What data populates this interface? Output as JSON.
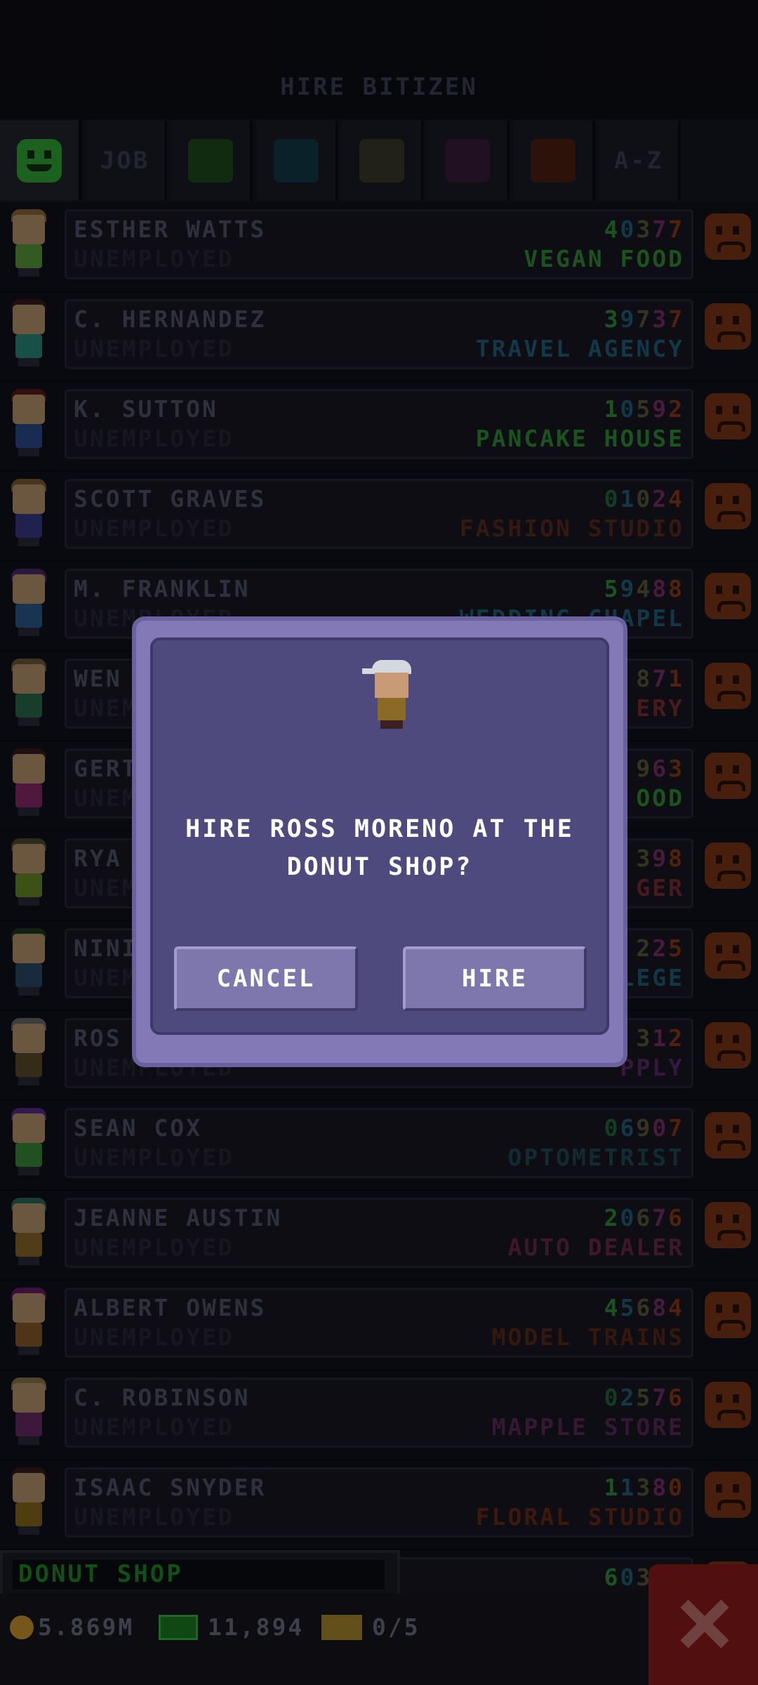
{
  "header": {
    "title": "HIRE BITIZEN"
  },
  "filters": [
    {
      "kind": "smiley",
      "color": "#33a83a"
    },
    {
      "kind": "text",
      "label": "JOB"
    },
    {
      "kind": "swatch",
      "color": "#1c4a1d"
    },
    {
      "kind": "swatch",
      "color": "#123a48"
    },
    {
      "kind": "swatch",
      "color": "#3a3a28"
    },
    {
      "kind": "swatch",
      "color": "#3a1a3c"
    },
    {
      "kind": "swatch",
      "color": "#4a2212"
    },
    {
      "kind": "text",
      "label": "A-Z"
    }
  ],
  "bitizens": [
    {
      "name": "ESTHER WATTS",
      "status": "UNEMPLOYED",
      "number": "40377",
      "business": "VEGAN FOOD",
      "biz_color": "#2f8f34",
      "digit_colors": [
        "#2f8f34",
        "#1f5f7a",
        "#5a5a3a",
        "#7a2f6a",
        "#8a3a18"
      ],
      "hair": "#8a6a3a",
      "shirt": "#5a9a3a"
    },
    {
      "name": "C. HERNANDEZ",
      "status": "UNEMPLOYED",
      "number": "39737",
      "business": "TRAVEL AGENCY",
      "biz_color": "#1f5f7a",
      "digit_colors": [
        "#2f8f34",
        "#1f5f7a",
        "#5a5a3a",
        "#7a2f6a",
        "#8a3a18"
      ],
      "hair": "#3a1a1a",
      "shirt": "#2a8a7a"
    },
    {
      "name": "K. SUTTON",
      "status": "UNEMPLOYED",
      "number": "10592",
      "business": "PANCAKE HOUSE",
      "biz_color": "#2f8f34",
      "digit_colors": [
        "#2f8f34",
        "#1f5f7a",
        "#5a5a3a",
        "#7a2f6a",
        "#8a3a18"
      ],
      "hair": "#5a1a1a",
      "shirt": "#2a4a8a"
    },
    {
      "name": "SCOTT GRAVES",
      "status": "UNEMPLOYED",
      "number": "01024",
      "business": "FASHION STUDIO",
      "biz_color": "#5a2a20",
      "digit_colors": [
        "#1f6a3a",
        "#1f5f7a",
        "#5a5a3a",
        "#7a2f6a",
        "#8a3a18"
      ],
      "hair": "#7a5a3a",
      "shirt": "#3a3a8a"
    },
    {
      "name": "M. FRANKLIN",
      "status": "UNEMPLOYED",
      "number": "59488",
      "business": "WEDDING CHAPEL",
      "biz_color": "#1f5f7a",
      "digit_colors": [
        "#2f8f34",
        "#1f5f7a",
        "#5a5a3a",
        "#7a2f6a",
        "#8a3a18"
      ],
      "hair": "#4a2a6a",
      "shirt": "#2a5a8a"
    },
    {
      "name": "WEN",
      "status": "UNEMPLOYED",
      "number": "871",
      "business": "ERY",
      "biz_color": "#7a2f30",
      "digit_colors": [
        "#5a5a3a",
        "#7a2f6a",
        "#8a3a18"
      ],
      "hair": "#6a5a3a",
      "shirt": "#2a6a4a"
    },
    {
      "name": "GERT",
      "status": "UNEMPLOYED",
      "number": "963",
      "business": "OOD",
      "biz_color": "#2f8f34",
      "digit_colors": [
        "#5a5a3a",
        "#7a2f6a",
        "#8a3a18"
      ],
      "hair": "#3a1a1a",
      "shirt": "#8a2a6a"
    },
    {
      "name": "RYA",
      "status": "UNEMPLOYED",
      "number": "398",
      "business": "GER",
      "biz_color": "#7a2f30",
      "digit_colors": [
        "#5a5a3a",
        "#7a2f6a",
        "#8a3a18"
      ],
      "hair": "#4a4a2a",
      "shirt": "#6a8a2a"
    },
    {
      "name": "NINI",
      "status": "UNEMPLOYED",
      "number": "225",
      "business": "LEGE",
      "biz_color": "#1f5f7a",
      "digit_colors": [
        "#5a5a3a",
        "#7a2f6a",
        "#8a3a18"
      ],
      "hair": "#1a3a1a",
      "shirt": "#2a4a6a"
    },
    {
      "name": "ROS",
      "status": "UNEMPLOYED",
      "number": "312",
      "business": "PPLY",
      "biz_color": "#5a2a6a",
      "digit_colors": [
        "#5a5a3a",
        "#7a2f6a",
        "#8a3a18"
      ],
      "hair": "#6a6a6a",
      "shirt": "#5a4a2a"
    },
    {
      "name": "SEAN COX",
      "status": "UNEMPLOYED",
      "number": "06907",
      "business": "OPTOMETRIST",
      "biz_color": "#1f4a58",
      "digit_colors": [
        "#1f6a3a",
        "#1f5f7a",
        "#5a5a3a",
        "#7a2f6a",
        "#8a3a18"
      ],
      "hair": "#5a2a8a",
      "shirt": "#3a8a3a"
    },
    {
      "name": "JEANNE AUSTIN",
      "status": "UNEMPLOYED",
      "number": "20676",
      "business": "AUTO DEALER",
      "biz_color": "#6a2a4a",
      "digit_colors": [
        "#2f8f34",
        "#1f5f7a",
        "#5a5a3a",
        "#7a2f6a",
        "#8a3a18"
      ],
      "hair": "#2a6a5a",
      "shirt": "#8a6a2a"
    },
    {
      "name": "ALBERT OWENS",
      "status": "UNEMPLOYED",
      "number": "45684",
      "business": "MODEL TRAINS",
      "biz_color": "#5a2a18",
      "digit_colors": [
        "#2f8f34",
        "#1f5f7a",
        "#5a5a3a",
        "#7a2f6a",
        "#8a3a18"
      ],
      "hair": "#6a1a6a",
      "shirt": "#8a5a2a"
    },
    {
      "name": "C. ROBINSON",
      "status": "UNEMPLOYED",
      "number": "02576",
      "business": "MAPPLE STORE",
      "biz_color": "#5a2a5a",
      "digit_colors": [
        "#1f6a3a",
        "#1f5f7a",
        "#5a5a3a",
        "#7a2f6a",
        "#8a3a18"
      ],
      "hair": "#8a7a4a",
      "shirt": "#6a2a6a"
    },
    {
      "name": "ISAAC SNYDER",
      "status": "UNEMPLOYED",
      "number": "11380",
      "business": "FLORAL STUDIO",
      "biz_color": "#6a2a18",
      "digit_colors": [
        "#2f8f34",
        "#1f5f7a",
        "#5a5a3a",
        "#7a2f6a",
        "#8a3a18"
      ],
      "hair": "#3a1a1a",
      "shirt": "#8a6a1a"
    },
    {
      "name": "",
      "status": "",
      "number": "60361",
      "business": "",
      "biz_color": "#1f5f7a",
      "digit_colors": [
        "#2f8f34",
        "#1f5f7a",
        "#5a5a3a",
        "#7a2f6a",
        "#8a3a18"
      ],
      "hair": "#333",
      "shirt": "#333"
    }
  ],
  "footer": {
    "business_label": "DONUT SHOP",
    "coins": "5.869M",
    "bux": "11,894",
    "tickets": "0/5"
  },
  "dialog": {
    "question": "HIRE ROSS MORENO AT THE DONUT SHOP?",
    "cancel_label": "CANCEL",
    "hire_label": "HIRE"
  }
}
